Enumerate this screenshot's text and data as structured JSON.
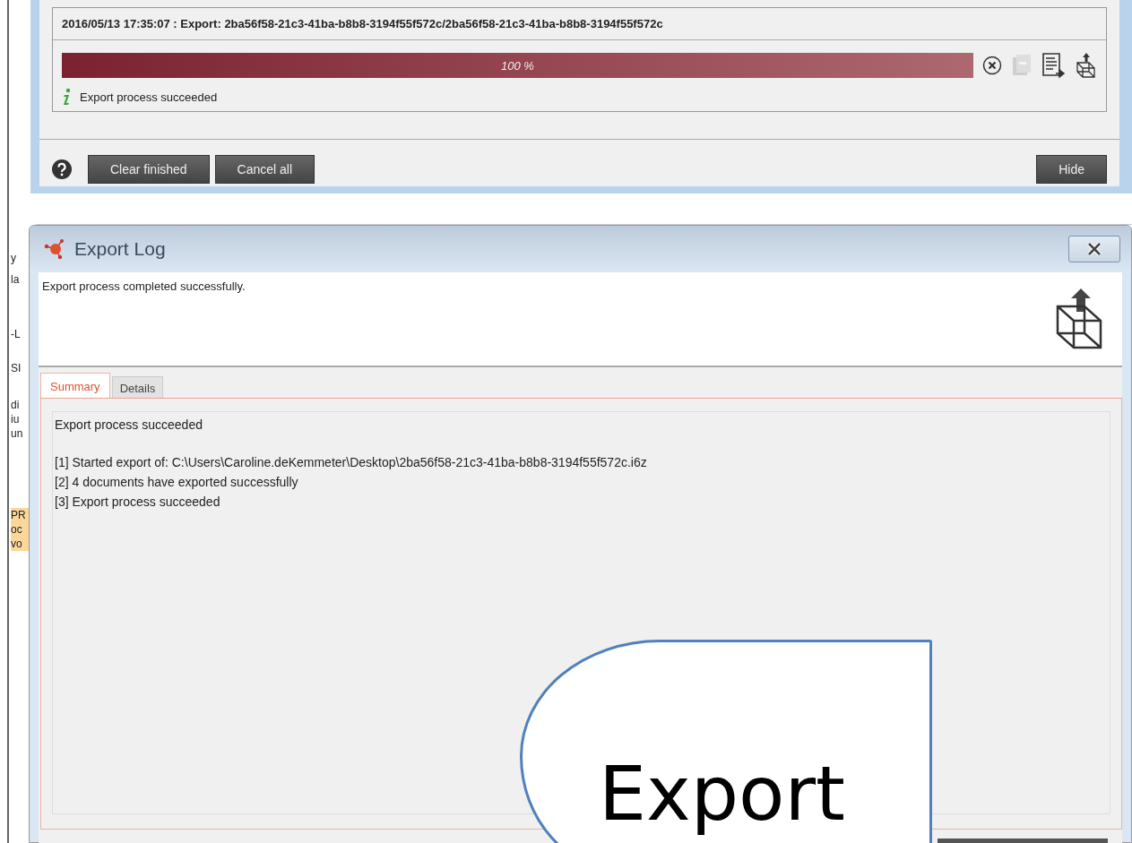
{
  "background_fragments": [
    "y",
    "la",
    "-L",
    "SI",
    "di",
    "iu",
    "un",
    "PR",
    "oc",
    "vo"
  ],
  "transfer_panel": {
    "header": "2016/05/13 17:35:07 : Export: 2ba56f58-21c3-41ba-b8b8-3194f55f572c/2ba56f58-21c3-41ba-b8b8-3194f55f572c",
    "progress": {
      "level": 1,
      "reading": "100 %"
    },
    "actions": [
      {
        "kind": "cancel",
        "disabled": false
      },
      {
        "kind": "open",
        "disabled": true
      },
      {
        "kind": "log",
        "disabled": false
      },
      {
        "kind": "export",
        "disabled": false
      }
    ],
    "status": "Export process succeeded",
    "buttons": [
      "Clear finished",
      "Cancel all"
    ],
    "hide_button": "Hide"
  },
  "export_log": {
    "title": "Export Log",
    "message": "Export process completed successfully.",
    "tabs": [
      {
        "label": "Summary",
        "selected": true
      },
      {
        "label": "Details",
        "selected": false
      }
    ],
    "summary_heading": "Export process succeeded",
    "log_lines": [
      "[1] Started export of: C:\\Users\\Caroline.deKemmeter\\Desktop\\2ba56f58-21c3-41ba-b8b8-3194f55f572c.i6z",
      "[2] 4 documents have exported successfully",
      "[3] Export process succeeded"
    ]
  },
  "callout": {
    "text": "Export"
  }
}
